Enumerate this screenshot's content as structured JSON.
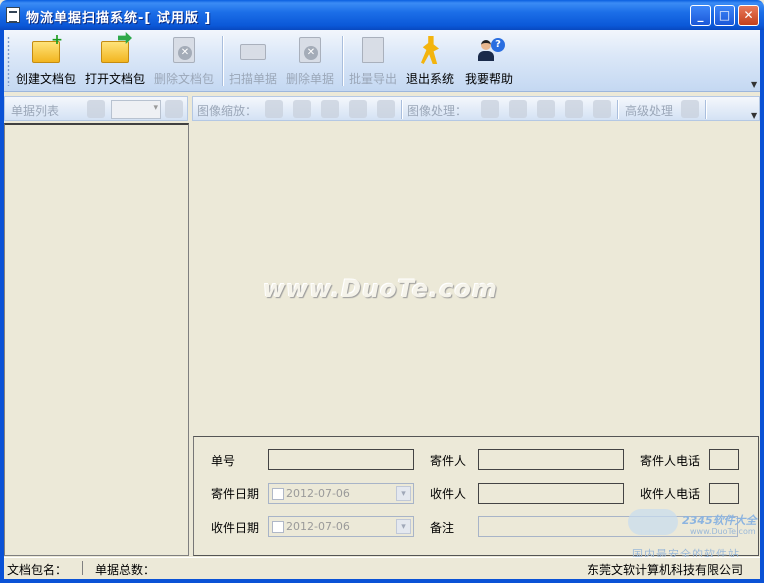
{
  "window": {
    "title": "物流单据扫描系统-[ 试用版 ]",
    "minimize_label": "_",
    "maximize_label": "□",
    "close_label": "✕"
  },
  "toolbar": {
    "create_package": "创建文档包",
    "open_package": "打开文档包",
    "delete_package": "删除文档包",
    "scan_document": "扫描单据",
    "delete_document": "删除单据",
    "batch_export": "批量导出",
    "exit_system": "退出系统",
    "help": "我要帮助"
  },
  "subbar": {
    "document_list": "单据列表",
    "image_zoom": "图像缩放：",
    "image_processing": "图像处理：",
    "advanced_processing": "高级处理"
  },
  "image_area": {
    "watermark": "www.DuoTe.com"
  },
  "form": {
    "order_no_label": "单号",
    "sender_label": "寄件人",
    "sender_phone_label": "寄件人电话",
    "send_date_label": "寄件日期",
    "send_date_value": "2012-07-06",
    "receiver_label": "收件人",
    "receiver_phone_label": "收件人电话",
    "receive_date_label": "收件日期",
    "receive_date_value": "2012-07-06",
    "remark_label": "备注"
  },
  "statusbar": {
    "package_name_label": "文档包名：",
    "document_total_label": "单据总数：",
    "company": "东莞文软计算机科技有限公司"
  },
  "site_watermark": {
    "logo": "2345软件大全",
    "url": "www.DuoTe.com",
    "slogan": "国内最安全的软件站"
  }
}
